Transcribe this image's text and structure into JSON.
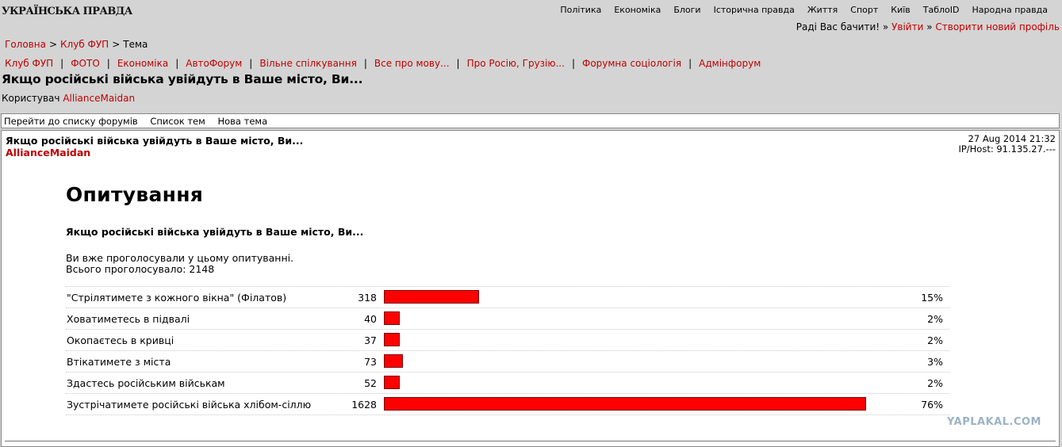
{
  "header": {
    "logo": "УКРАЇНСЬКА ПРАВДА",
    "topnav": [
      "Політика",
      "Економіка",
      "Блоги",
      "Історична правда",
      "Життя",
      "Спорт",
      "Київ",
      "ТаблоID",
      "Народна правда"
    ],
    "greeting": "Раді Вас бачити!",
    "login": "Увійти",
    "register": "Створити новий профіль",
    "sep": "»"
  },
  "breadcrumb": [
    "Головна",
    "Клуб ФУП",
    "Тема"
  ],
  "forums": [
    "Клуб ФУП",
    "ФОТО",
    "Економіка",
    "АвтоФорум",
    "Вільне спілкування",
    "Все про мову...",
    "Про Росію, Грузію...",
    "Форумна соціологія",
    "Адмінфорум"
  ],
  "page": {
    "title": "Якщо російські війська увійдуть в Ваше місто, Ви...",
    "user_label": "Користувач",
    "user_name": "AllianceMaidan"
  },
  "toolbar": [
    "Перейти до списку форумів",
    "Список тем",
    "Нова тема"
  ],
  "post": {
    "title": "Якщо російські війська увійдуть в Ваше місто, Ви...",
    "author": "AllianceMaidan",
    "date": "27 Aug 2014 21:32",
    "host": "IP/Host: 91.135.27.---"
  },
  "poll": {
    "heading": "Опитування",
    "question": "Якщо російські війська увійдуть в Ваше місто, Ви...",
    "voted_note": "Ви вже проголосували у цьому опитуванні.",
    "total_label": "Всього проголосувало: 2148",
    "options": [
      {
        "label": "\"Стрілятимете з кожного вікна\" (Філатов)",
        "count": "318",
        "percent": "15%",
        "share": 0.15
      },
      {
        "label": "Ховатиметесь в підвалі",
        "count": "40",
        "percent": "2%",
        "share": 0.02
      },
      {
        "label": "Окопаєтесь в кривці",
        "count": "37",
        "percent": "2%",
        "share": 0.02
      },
      {
        "label": "Втікатимете з міста",
        "count": "73",
        "percent": "3%",
        "share": 0.03
      },
      {
        "label": "Здастесь російським військам",
        "count": "52",
        "percent": "2%",
        "share": 0.02
      },
      {
        "label": "Зустрічатимете російські війська хлібом-сіллю",
        "count": "1628",
        "percent": "76%",
        "share": 0.76
      }
    ]
  },
  "watermark": "YAPLAKAL.COM",
  "colors": {
    "accent": "#c00000",
    "bar": "#ff0000",
    "background": "#d4d4d4"
  }
}
